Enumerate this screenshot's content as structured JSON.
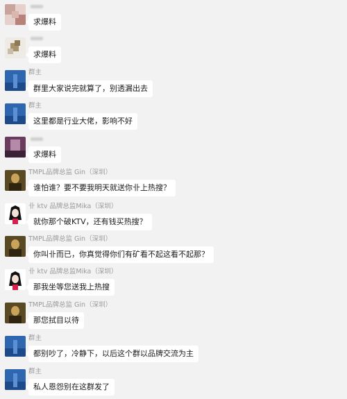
{
  "messages": [
    {
      "sender": "",
      "text": "求爆料",
      "avatar_icon": "pixelated-avatar-pink"
    },
    {
      "sender": "",
      "text": "求爆料",
      "avatar_icon": "pixelated-avatar-brown"
    },
    {
      "sender": "群主",
      "text": "群里大家说完就算了，别透漏出去",
      "avatar_icon": "group-owner-blue-avatar"
    },
    {
      "sender": "群主",
      "text": "这里都是行业大佬，影响不好",
      "avatar_icon": "group-owner-blue-avatar"
    },
    {
      "sender": "",
      "text": "求爆料",
      "avatar_icon": "pixelated-avatar-purple"
    },
    {
      "sender": "TMPL品牌总监 Gin（深圳）",
      "text": "谁怕谁？要不要我明天就送你卝上热搜？",
      "avatar_icon": "mona-lisa-avatar"
    },
    {
      "sender": "卝 ktv 品牌总监Mika（深圳）",
      "text": "就你那个破KTV，还有钱买热搜？",
      "avatar_icon": "anime-girl-avatar"
    },
    {
      "sender": "TMPL品牌总监 Gin（深圳）",
      "text": "你叫卝而已，你真觉得你们有矿看不起这看不起那？",
      "avatar_icon": "mona-lisa-avatar"
    },
    {
      "sender": "卝 ktv 品牌总监Mika（深圳）",
      "text": "那我坐等您送我上热搜",
      "avatar_icon": "anime-girl-avatar"
    },
    {
      "sender": "TMPL品牌总监 Gin（深圳）",
      "text": "那您拭目以待",
      "avatar_icon": "mona-lisa-avatar"
    },
    {
      "sender": "群主",
      "text": "都别吵了，冷静下，以后这个群以品牌交流为主",
      "avatar_icon": "group-owner-blue-avatar"
    },
    {
      "sender": "群主",
      "text": "私人恩怨别在这群发了",
      "avatar_icon": "group-owner-blue-avatar"
    }
  ]
}
